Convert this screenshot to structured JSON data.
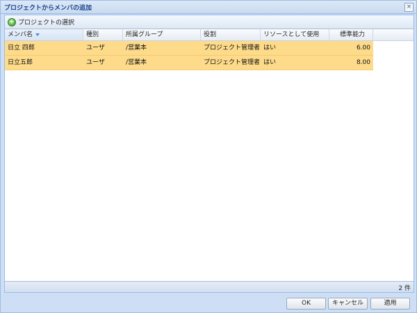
{
  "dialog": {
    "title": "プロジェクトからメンバの追加",
    "close_glyph": "×"
  },
  "toolbar": {
    "select_project_label": "プロジェクトの選択",
    "icon": "add-circle-icon"
  },
  "grid": {
    "columns": [
      {
        "label": "メンバ名",
        "sorted": "desc"
      },
      {
        "label": "種別"
      },
      {
        "label": "所属グループ"
      },
      {
        "label": "役割"
      },
      {
        "label": "リソースとして使用"
      },
      {
        "label": "標準能力"
      }
    ],
    "rows": [
      {
        "name": "日立 四郎",
        "type": "ユーザ",
        "group": "/営業本",
        "role": "プロジェクト管理者",
        "resource": "はい",
        "capacity": "6.00"
      },
      {
        "name": "日立五郎",
        "type": "ユーザ",
        "group": "/営業本",
        "role": "プロジェクト管理者",
        "resource": "はい",
        "capacity": "8.00"
      }
    ],
    "selected_row_color": "#fddb8a"
  },
  "status": {
    "count_text": "2 件"
  },
  "buttons": {
    "ok": "OK",
    "cancel": "キャンセル",
    "apply": "適用"
  }
}
